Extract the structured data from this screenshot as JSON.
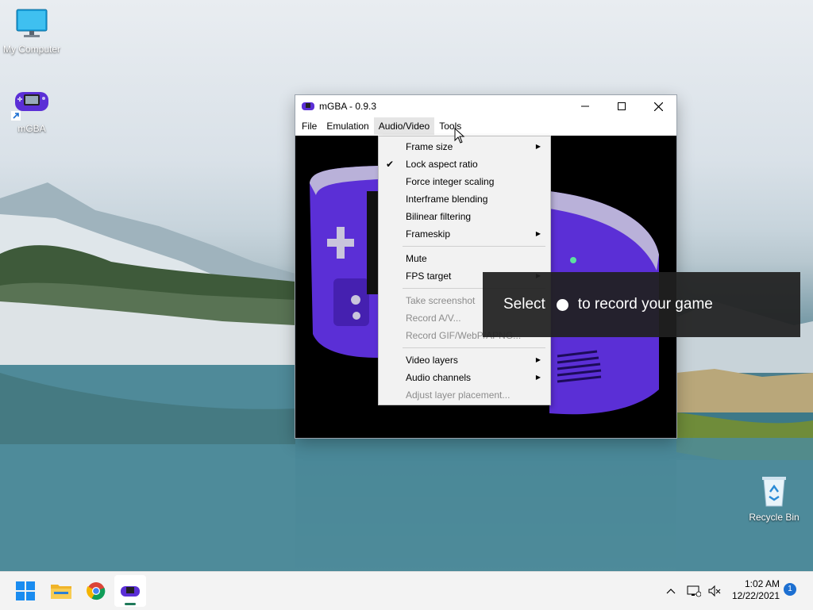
{
  "desktop": {
    "icons": [
      {
        "label": "My Computer"
      },
      {
        "label": "mGBA"
      },
      {
        "label": "Recycle Bin"
      }
    ]
  },
  "window": {
    "title": "mGBA - 0.9.3",
    "menu": [
      "File",
      "Emulation",
      "Audio/Video",
      "Tools"
    ]
  },
  "dropdown": {
    "items": [
      {
        "label": "Frame size",
        "submenu": true,
        "enabled": true
      },
      {
        "label": "Lock aspect ratio",
        "checked": true,
        "enabled": true
      },
      {
        "label": "Force integer scaling",
        "enabled": true
      },
      {
        "label": "Interframe blending",
        "enabled": true
      },
      {
        "label": "Bilinear filtering",
        "enabled": true
      },
      {
        "label": "Frameskip",
        "submenu": true,
        "enabled": true
      },
      {
        "label": "Mute",
        "enabled": true
      },
      {
        "label": "FPS target",
        "submenu": true,
        "enabled": true
      },
      {
        "label": "Take screenshot",
        "enabled": false
      },
      {
        "label": "Record A/V...",
        "enabled": false
      },
      {
        "label": "Record GIF/WebP/APNG...",
        "enabled": false
      },
      {
        "label": "Video layers",
        "submenu": true,
        "enabled": true
      },
      {
        "label": "Audio channels",
        "submenu": true,
        "enabled": true
      },
      {
        "label": "Adjust layer placement...",
        "enabled": false
      }
    ]
  },
  "overlay": {
    "before": "Select",
    "after": "to record your game"
  },
  "taskbar": {
    "time": "1:02 AM",
    "date": "12/22/2021",
    "notification_count": "1"
  },
  "colors": {
    "gba_purple": "#5b2fd6",
    "taskbar_bg": "#f3f3f3",
    "accent": "#1c6fd1"
  }
}
